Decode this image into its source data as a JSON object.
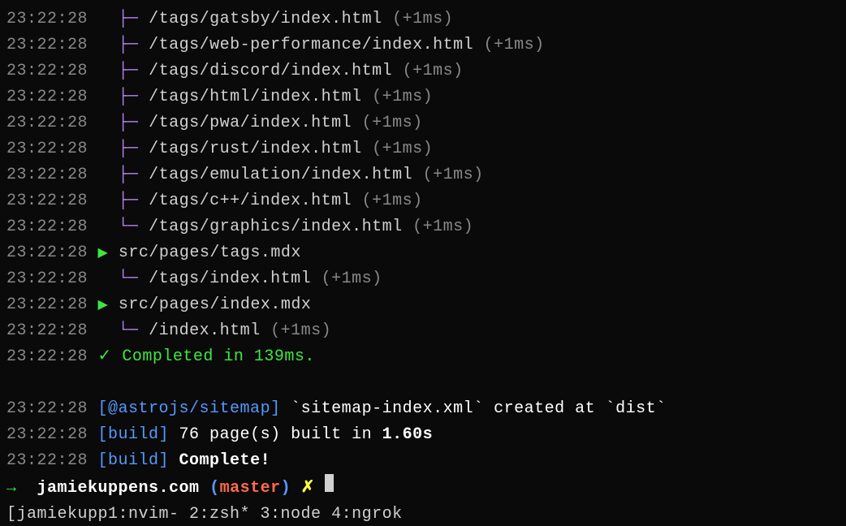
{
  "timestamp": "23:22:28",
  "build_lines": [
    {
      "type": "tree-mid",
      "path": "/tags/gatsby/index.html",
      "timing": "(+1ms)"
    },
    {
      "type": "tree-mid",
      "path": "/tags/web-performance/index.html",
      "timing": "(+1ms)"
    },
    {
      "type": "tree-mid",
      "path": "/tags/discord/index.html",
      "timing": "(+1ms)"
    },
    {
      "type": "tree-mid",
      "path": "/tags/html/index.html",
      "timing": "(+1ms)"
    },
    {
      "type": "tree-mid",
      "path": "/tags/pwa/index.html",
      "timing": "(+1ms)"
    },
    {
      "type": "tree-mid",
      "path": "/tags/rust/index.html",
      "timing": "(+1ms)"
    },
    {
      "type": "tree-mid",
      "path": "/tags/emulation/index.html",
      "timing": "(+1ms)"
    },
    {
      "type": "tree-mid",
      "path": "/tags/c++/index.html",
      "timing": "(+1ms)"
    },
    {
      "type": "tree-end",
      "path": "/tags/graphics/index.html",
      "timing": "(+1ms)"
    },
    {
      "type": "source",
      "path": "src/pages/tags.mdx"
    },
    {
      "type": "tree-end",
      "path": "/tags/index.html",
      "timing": "(+1ms)"
    },
    {
      "type": "source",
      "path": "src/pages/index.mdx"
    },
    {
      "type": "tree-end",
      "path": "/index.html",
      "timing": "(+1ms)"
    },
    {
      "type": "completed",
      "text": "Completed in 139ms."
    }
  ],
  "info_lines": [
    {
      "tag": "[@astrojs/sitemap]",
      "parts": [
        {
          "text": " `sitemap-index.xml` created at `dist`",
          "cls": "white"
        }
      ]
    },
    {
      "tag": "[build]",
      "parts": [
        {
          "text": " 76 page(s) built in ",
          "cls": "white"
        },
        {
          "text": "1.60s",
          "cls": "white bold"
        }
      ]
    },
    {
      "tag": "[build]",
      "parts": [
        {
          "text": " Complete!",
          "cls": "white bold"
        }
      ]
    }
  ],
  "prompt": {
    "arrow": "→",
    "dir": "jamiekuppens.com",
    "branch": "master",
    "x": "✗"
  },
  "statusbar": "[jamiekupp1:nvim- 2:zsh* 3:node  4:ngrok",
  "glyphs": {
    "tree_mid": "├─",
    "tree_end": "└─",
    "source_arrow": "▶",
    "check": "✓"
  }
}
